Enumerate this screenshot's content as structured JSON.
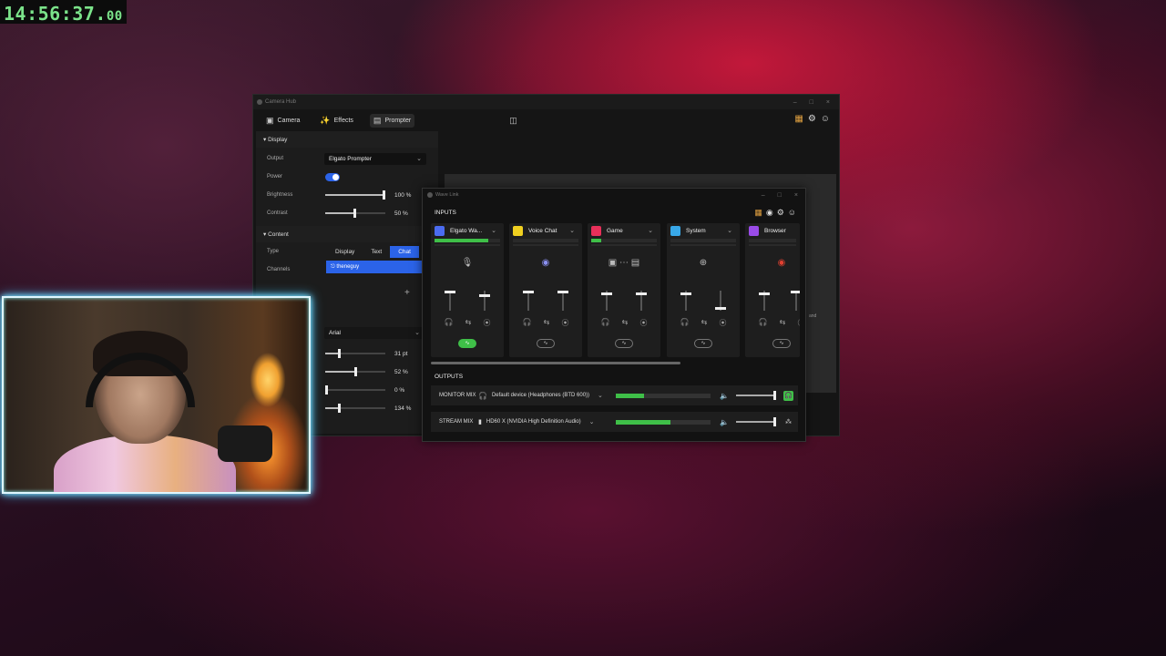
{
  "timer": {
    "main": "14:56:37.",
    "fraction": "00"
  },
  "camera_hub": {
    "title": "Camera Hub",
    "tabs": [
      {
        "label": "Camera",
        "icon": "camera-icon"
      },
      {
        "label": "Effects",
        "icon": "effects-icon"
      },
      {
        "label": "Prompter",
        "icon": "prompter-icon"
      }
    ],
    "display_section": "Display",
    "output_label": "Output",
    "output_value": "Elgato Prompter",
    "power_label": "Power",
    "power_on": true,
    "brightness_label": "Brightness",
    "brightness_value": "100 %",
    "contrast_label": "Contrast",
    "contrast_value": "50 %",
    "content_section": "Content",
    "type_label": "Type",
    "type_options": [
      "Display",
      "Text",
      "Chat"
    ],
    "type_selected": "Chat",
    "channels_label": "Channels",
    "channel_value": "theneguy",
    "font_value": "Arial",
    "font_size": "31 pt",
    "p2": "52 %",
    "p3": "0 %",
    "p4": "134 %",
    "side_text": "and"
  },
  "wave_link": {
    "title": "Wave Link",
    "inputs_label": "INPUTS",
    "outputs_label": "OUTPUTS",
    "channels": [
      {
        "name": "Elgato Wa...",
        "color": "#4b6cf0",
        "level": 0.82,
        "icon": "microphone-icon",
        "active": true
      },
      {
        "name": "Voice Chat",
        "color": "#f0d020",
        "level": 0.0,
        "icon": "discord-icon",
        "active": false
      },
      {
        "name": "Game",
        "color": "#e8305a",
        "level": 0.15,
        "icon": "game-icon",
        "active": false
      },
      {
        "name": "System",
        "color": "#38a8e8",
        "level": 0.0,
        "icon": "add-icon",
        "active": false
      },
      {
        "name": "Browser",
        "color": "#9a4be8",
        "level": 0.0,
        "icon": "chrome-icon",
        "active": false
      }
    ],
    "outputs": [
      {
        "name": "MONITOR MIX",
        "device": "Default device (Headphones (BTD 600))",
        "icon": "headphones-icon",
        "level": 0.3,
        "volume": 0.95
      },
      {
        "name": "STREAM MIX",
        "device": "HD60 X (NVIDIA High Definition Audio)",
        "icon": "device-icon",
        "level": 0.58,
        "volume": 0.95
      }
    ]
  }
}
